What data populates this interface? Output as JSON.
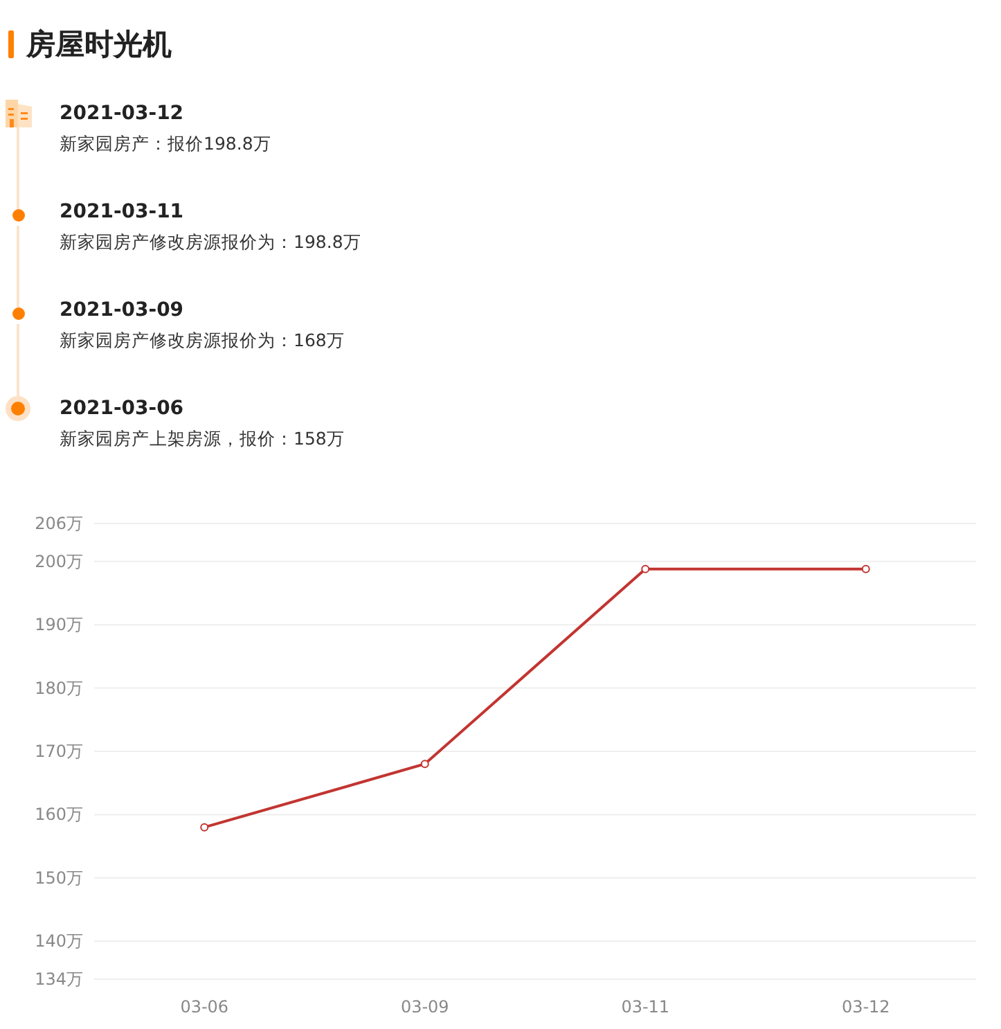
{
  "title": "房屋时光机",
  "timeline": [
    {
      "kind": "building",
      "date": "2021-03-12",
      "text": "新家园房产：报价198.8万"
    },
    {
      "kind": "dot",
      "date": "2021-03-11",
      "text": "新家园房产修改房源报价为：198.8万"
    },
    {
      "kind": "dot",
      "date": "2021-03-09",
      "text": "新家园房产修改房源报价为：168万"
    },
    {
      "kind": "ring",
      "date": "2021-03-06",
      "text": "新家园房产上架房源，报价：158万"
    }
  ],
  "chart": {
    "chart_data": {
      "type": "line",
      "categories": [
        "03-06",
        "03-09",
        "03-11",
        "03-12"
      ],
      "grid": true,
      "series": [
        {
          "color": "#c23531",
          "marker": true,
          "values": [
            158,
            168,
            198.8,
            198.8
          ]
        }
      ],
      "ylim": [
        134,
        206
      ],
      "yticks": [
        {
          "value": 134,
          "label": "134万"
        },
        {
          "value": 140,
          "label": "140万"
        },
        {
          "value": 150,
          "label": "150万"
        },
        {
          "value": 160,
          "label": "160万"
        },
        {
          "value": 170,
          "label": "170万"
        },
        {
          "value": 180,
          "label": "180万"
        },
        {
          "value": 190,
          "label": "190万"
        },
        {
          "value": 200,
          "label": "200万"
        },
        {
          "value": 206,
          "label": "206万"
        }
      ]
    }
  }
}
